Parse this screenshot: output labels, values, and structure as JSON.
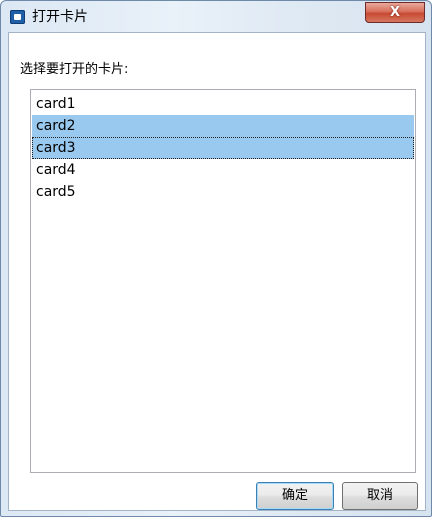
{
  "window": {
    "title": "打开卡片",
    "close_label": "X"
  },
  "dialog": {
    "prompt": "选择要打开的卡片:",
    "items": [
      {
        "label": "card1",
        "selected": false,
        "focused": false
      },
      {
        "label": "card2",
        "selected": true,
        "focused": false
      },
      {
        "label": "card3",
        "selected": true,
        "focused": true
      },
      {
        "label": "card4",
        "selected": false,
        "focused": false
      },
      {
        "label": "card5",
        "selected": false,
        "focused": false
      }
    ],
    "ok_label": "确定",
    "cancel_label": "取消"
  },
  "colors": {
    "selection": "#99c9ef",
    "close_button": "#c84a33"
  }
}
